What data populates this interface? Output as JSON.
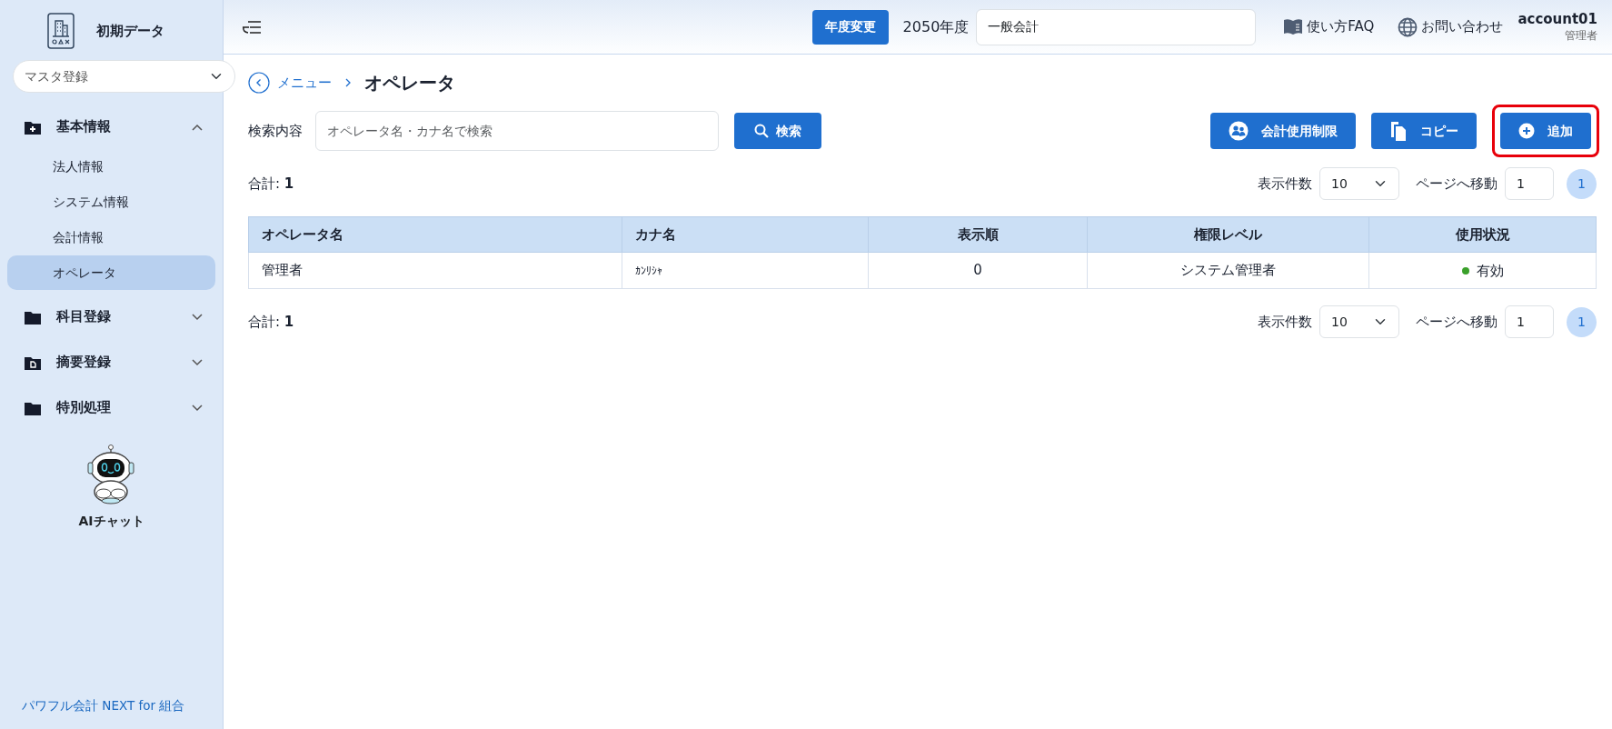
{
  "sidebar": {
    "title": "初期データ",
    "menu_select": {
      "value": "マスタ登録"
    },
    "groups": [
      {
        "kind": "plus",
        "label": "基本情報",
        "expanded": true,
        "children": [
          {
            "label": "法人情報",
            "selected": false
          },
          {
            "label": "システム情報",
            "selected": false
          },
          {
            "label": "会計情報",
            "selected": false
          },
          {
            "label": "オペレータ",
            "selected": true
          }
        ]
      },
      {
        "kind": "plain",
        "label": "科目登録",
        "expanded": false
      },
      {
        "kind": "document",
        "label": "摘要登録",
        "expanded": false
      },
      {
        "kind": "plain",
        "label": "特別処理",
        "expanded": false
      }
    ],
    "ai_chat": {
      "label": "AIチャット"
    },
    "footer": "パワフル会計 NEXT for 組合"
  },
  "header": {
    "year_button": "年度変更",
    "fiscal_year": "2050年度",
    "account_field": {
      "value": "一般会計"
    },
    "links": [
      {
        "kind": "book",
        "label": "使い方FAQ"
      },
      {
        "kind": "globe",
        "label": "お問い合わせ"
      }
    ],
    "user": {
      "name": "account01",
      "role": "管理者"
    }
  },
  "breadcrumb": {
    "back_link": "メニュー",
    "current": "オペレータ"
  },
  "search": {
    "label": "検索内容",
    "placeholder": "オペレータ名・カナ名で検索",
    "button": "検索"
  },
  "actions": [
    {
      "kind": "usage",
      "label": "会計使用制限",
      "highlighted": false
    },
    {
      "kind": "copy",
      "label": "コピー",
      "highlighted": false
    },
    {
      "kind": "add",
      "label": "追加",
      "highlighted": true
    }
  ],
  "pager_top": {
    "total": "合計: **1**",
    "per_page_label": "表示件数",
    "per_page": "10",
    "goto_label": "ページへ移動",
    "goto_value": "1",
    "pages": [
      {
        "label": "1",
        "selected": true
      }
    ]
  },
  "table": {
    "columns": [
      "オペレータ名",
      "カナ名",
      "表示順",
      "権限レベル",
      "使用状況"
    ],
    "rows": [
      {
        "cells": [
          "管理者",
          "ｶﾝﾘｼｬ",
          "0",
          "システム管理者"
        ],
        "status": {
          "label": "有効",
          "color": "#3aa02a"
        }
      }
    ]
  },
  "pager_bottom": {
    "total": "合計: **1**",
    "per_page_label": "表示件数",
    "per_page": "10",
    "goto_label": "ページへ移動",
    "goto_value": "1",
    "pages": [
      {
        "label": "1",
        "selected": true
      }
    ]
  }
}
